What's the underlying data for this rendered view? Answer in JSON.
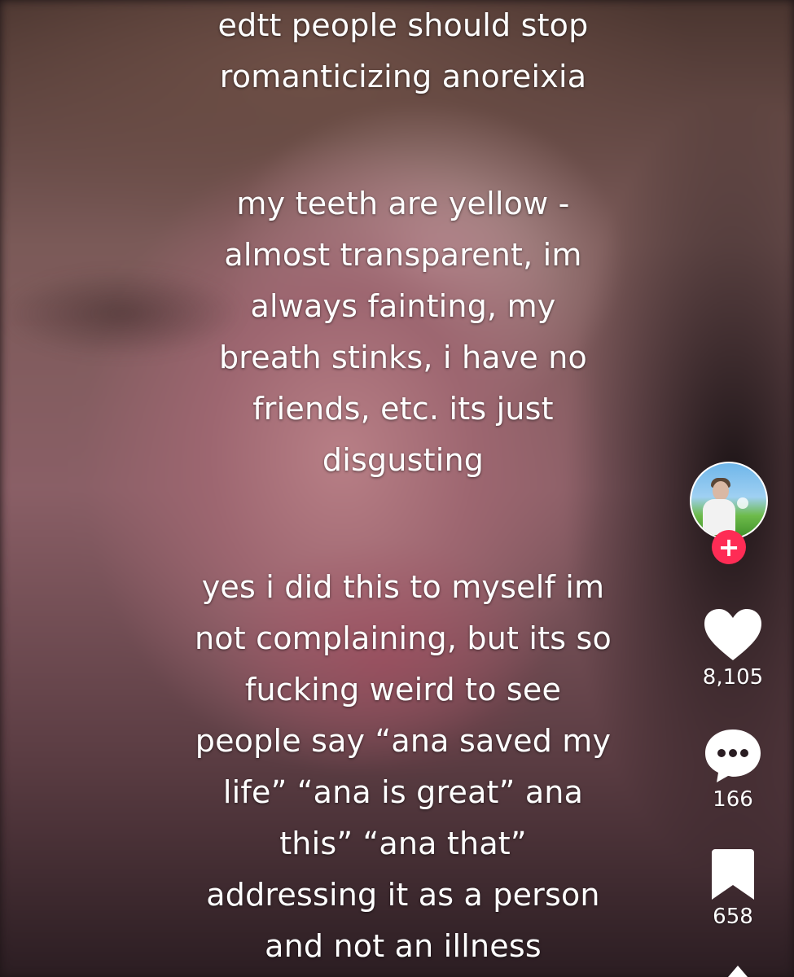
{
  "caption": {
    "paragraph_1": [
      "edtt people should stop",
      "romanticizing anoreixia"
    ],
    "paragraph_2": [
      "my teeth are yellow -",
      "almost transparent, im",
      "always fainting, my",
      "breath stinks, i have no",
      "friends, etc. its just",
      "disgusting"
    ],
    "paragraph_3": [
      "yes i did this to myself im",
      "not complaining, but its so",
      "fucking weird to see",
      "people say “ana saved my",
      "life” “ana is great” ana",
      "this” “ana that”",
      "addressing it as a person",
      "and not an illness"
    ]
  },
  "rail": {
    "follow_symbol": "+",
    "like_count": "8,105",
    "comment_count": "166",
    "save_count": "658",
    "icons": {
      "like": "heart-icon",
      "comment": "comment-bubble-icon",
      "save": "bookmark-icon",
      "share": "share-arrow-icon"
    }
  },
  "colors": {
    "text": "#ffffff",
    "follow_accent": "#fe2c55"
  }
}
